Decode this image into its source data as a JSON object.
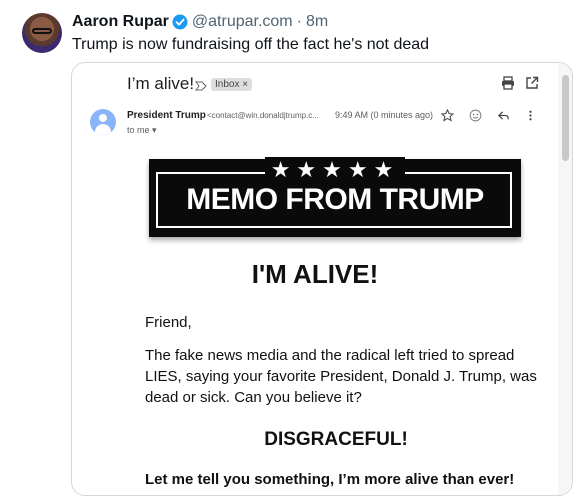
{
  "tweet": {
    "author_name": "Aaron Rupar",
    "handle": "@atrupar.com",
    "separator": "·",
    "time": "8m",
    "text": "Trump is now fundraising off the fact he's not dead",
    "verified_color": "#1d9bf0"
  },
  "email": {
    "subject": "I’m alive!",
    "label": "Inbox ×",
    "sender_name": "President Trump",
    "sender_email": "<contact@win.donaldjtrump.c...",
    "time": "9:49 AM (0 minutes ago)",
    "recipient": "to me ▾",
    "banner_stars": "★★★★★",
    "banner_text": "MEMO FROM TRUMP",
    "heading": "I'M ALIVE!",
    "greeting": "Friend,",
    "paragraph": "The fake news media and the radical left tried to spread LIES, saying your favorite President, Donald J. Trump, was dead or sick. Can you believe it?",
    "emphasis": "DISGRACEFUL!",
    "closing": "Let me tell you something, I’m more alive than ever!"
  },
  "icons": [
    "verified-icon",
    "important-icon",
    "print-icon",
    "open-in-new-icon",
    "star-icon",
    "emoji-icon",
    "reply-icon",
    "more-vert-icon"
  ]
}
